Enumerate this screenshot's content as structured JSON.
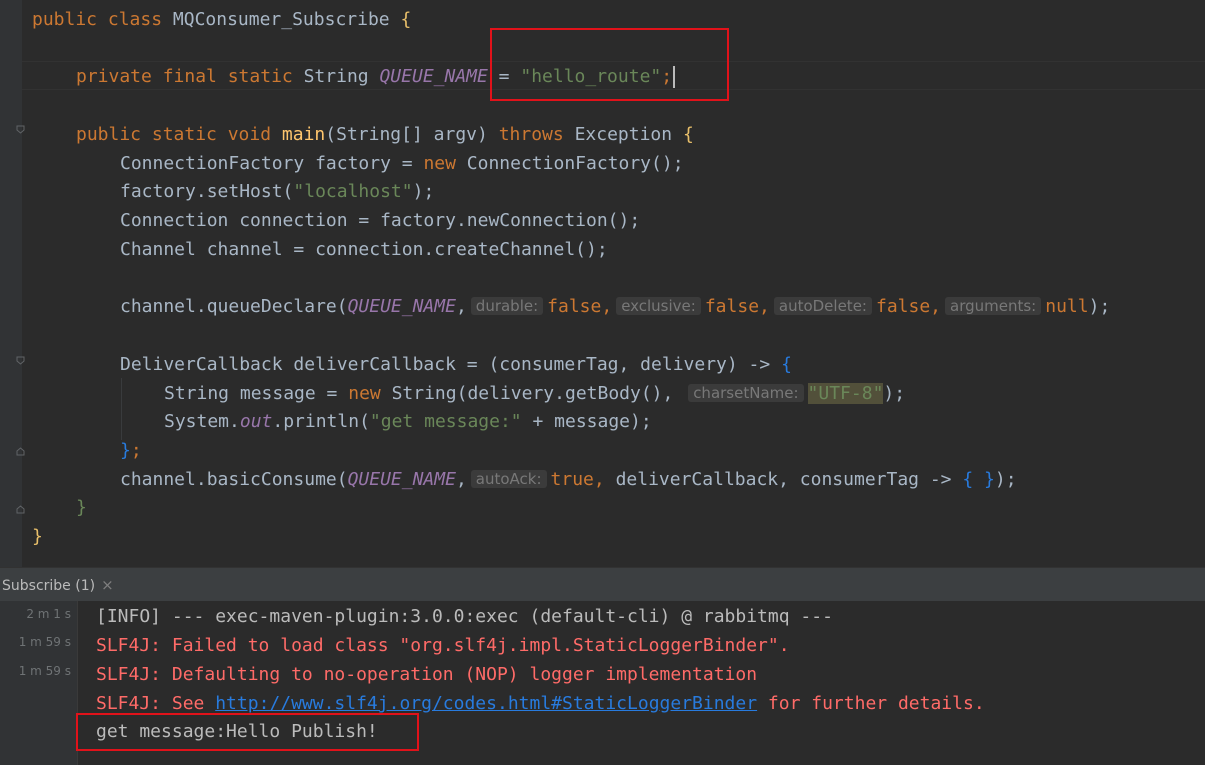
{
  "editor": {
    "class_line": {
      "mod": "public class",
      "name": "MQConsumer_Subscribe",
      "open": "{"
    },
    "field_line": {
      "mods": "private final static",
      "type": "String",
      "name": "QUEUE_NAME",
      "eq": " = ",
      "value": "\"hello_route\"",
      "semi": ";"
    },
    "main_line": {
      "mods": "public static void",
      "name": "main",
      "params": "(String[] argv)",
      "throws": "throws",
      "exc": "Exception",
      "open": "{"
    },
    "l_factory": {
      "type": "ConnectionFactory factory = ",
      "new": "new",
      "rest": " ConnectionFactory();"
    },
    "l_host": {
      "pre": "factory.setHost(",
      "str": "\"localhost\"",
      "post": ");"
    },
    "l_conn": "Connection connection = factory.newConnection();",
    "l_chan": "Channel channel = connection.createChannel();",
    "l_declare": {
      "pre": "channel.queueDeclare(",
      "field": "QUEUE_NAME",
      "h1": "durable:",
      "v1": "false,",
      "h2": "exclusive:",
      "v2": "false,",
      "h3": "autoDelete:",
      "v3": "false,",
      "h4": "arguments:",
      "v4": "null",
      "post": ");"
    },
    "l_cb": {
      "pre": "DeliverCallback deliverCallback = ",
      "args": "(consumerTag, delivery)",
      "arrow": " -> ",
      "open": "{"
    },
    "l_msg": {
      "pre": "String message = ",
      "new": "new",
      "mid": " String(delivery.getBody(), ",
      "hint": "charsetName:",
      "str": "\"UTF-8\"",
      "post": ");"
    },
    "l_print": {
      "pre": "System.",
      "out": "out",
      "mid": ".println(",
      "str": "\"get message:\"",
      "post": " + message);"
    },
    "l_cb_close": {
      "brace": "}",
      "semi": ";"
    },
    "l_consume": {
      "pre": "channel.basicConsume(",
      "field": "QUEUE_NAME",
      "h1": "autoAck:",
      "v1": "true,",
      "rest": " deliverCallback, consumerTag -> ",
      "lam": "{ }",
      "post": ");"
    },
    "l_main_close": "}",
    "l_class_close": "}"
  },
  "run_panel": {
    "tab_label": "Subscribe (1)",
    "close_icon": "×",
    "times": [
      "2 m 1 s",
      "1 m 59 s",
      "1 m 59 s"
    ],
    "lines": {
      "info": "[INFO] --- exec-maven-plugin:3.0.0:exec (default-cli) @ rabbitmq ---",
      "err1": "SLF4J: Failed to load class \"org.slf4j.impl.StaticLoggerBinder\".",
      "err2": "SLF4J: Defaulting to no-operation (NOP) logger implementation",
      "err3_pre": "SLF4J: See ",
      "err3_link": "http://www.slf4j.org/codes.html#StaticLoggerBinder",
      "err3_post": " for further details.",
      "result": "get message:Hello Publish!"
    }
  },
  "colors": {
    "highlight_box": "#e1121a",
    "editor_bg": "#2b2b2b"
  }
}
